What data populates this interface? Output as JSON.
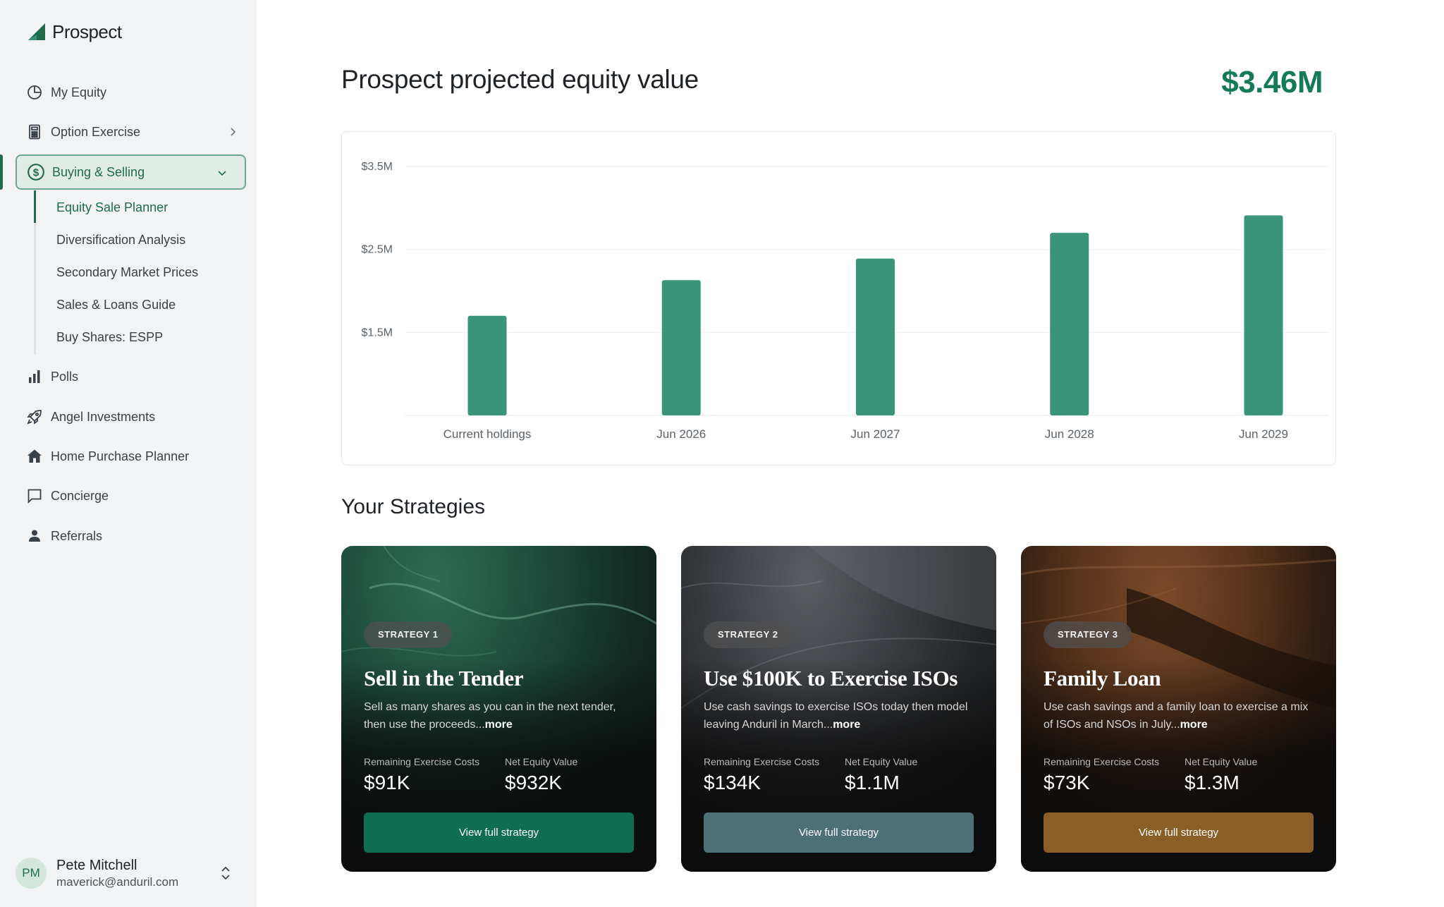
{
  "app": {
    "name": "Prospect"
  },
  "sidebar": {
    "items": [
      {
        "label": "My Equity",
        "icon": "pie-chart-icon"
      },
      {
        "label": "Option Exercise",
        "icon": "calculator-icon"
      },
      {
        "label": "Buying & Selling",
        "icon": "dollar-circle-icon",
        "active": true
      },
      {
        "label": "Polls",
        "icon": "bar-chart-icon"
      },
      {
        "label": "Angel Investments",
        "icon": "rocket-icon"
      },
      {
        "label": "Home Purchase Planner",
        "icon": "home-icon"
      },
      {
        "label": "Concierge",
        "icon": "chat-icon"
      },
      {
        "label": "Referrals",
        "icon": "person-icon"
      }
    ],
    "subitems": [
      {
        "label": "Equity Sale Planner",
        "active": true
      },
      {
        "label": "Diversification Analysis"
      },
      {
        "label": "Secondary Market Prices"
      },
      {
        "label": "Sales & Loans Guide"
      },
      {
        "label": "Buy Shares: ESPP"
      }
    ],
    "user": {
      "initials": "PM",
      "name": "Pete Mitchell",
      "email": "maverick@anduril.com"
    }
  },
  "main": {
    "title": "Prospect projected equity value",
    "total": "$3.46M",
    "strategies_title": "Your Strategies"
  },
  "chart_data": {
    "type": "bar",
    "categories": [
      "Current holdings",
      "Jun 2026",
      "Jun 2027",
      "Jun 2028",
      "Jun 2029"
    ],
    "values": [
      1.7,
      2.13,
      2.39,
      2.7,
      2.91
    ],
    "yticks": [
      "$3.5M",
      "$2.5M",
      "$1.5M"
    ],
    "ytick_values": [
      3.5,
      2.5,
      1.5
    ],
    "ylim": [
      0.5,
      3.5
    ],
    "color": "#3a947a",
    "grid": true
  },
  "strategies": [
    {
      "badge": "STRATEGY 1",
      "title": "Sell in the Tender",
      "desc": "Sell as many shares as you can in the next tender, then use the proceeds...",
      "more": "more",
      "m1_label": "Remaining Exercise Costs",
      "m1_value": "$91K",
      "m2_label": "Net Equity Value",
      "m2_value": "$932K",
      "button": "View full strategy",
      "button_color": "#0f6e51"
    },
    {
      "badge": "STRATEGY 2",
      "title": "Use $100K to Exercise ISOs",
      "desc": "Use cash savings to exercise ISOs today then model leaving Anduril in March...",
      "more": "more",
      "m1_label": "Remaining Exercise Costs",
      "m1_value": "$134K",
      "m2_label": "Net Equity Value",
      "m2_value": "$1.1M",
      "button": "View full strategy",
      "button_color": "#4d7078"
    },
    {
      "badge": "STRATEGY 3",
      "title": "Family Loan",
      "desc": "Use cash savings and a family loan to exercise a mix of ISOs and NSOs in July...",
      "more": "more",
      "m1_label": "Remaining Exercise Costs",
      "m1_value": "$73K",
      "m2_label": "Net Equity Value",
      "m2_value": "$1.3M",
      "button": "View full strategy",
      "button_color": "#8a5e27"
    }
  ]
}
